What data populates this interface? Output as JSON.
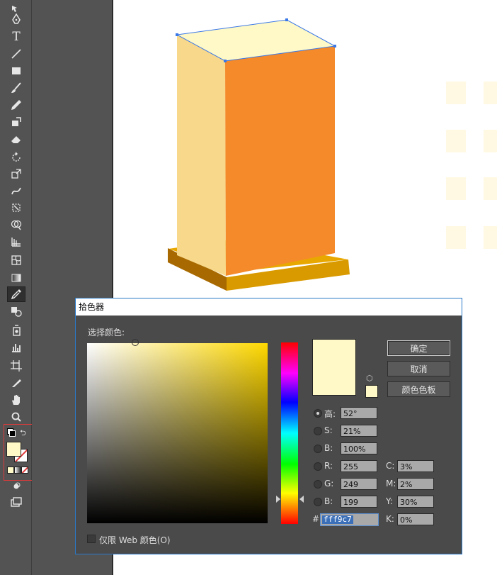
{
  "toolbar": {
    "tools": [
      {
        "name": "direct-selection-icon"
      },
      {
        "name": "pen-icon"
      },
      {
        "name": "type-icon",
        "glyph": "T"
      },
      {
        "name": "line-icon"
      },
      {
        "name": "rectangle-icon"
      },
      {
        "name": "paintbrush-icon"
      },
      {
        "name": "pencil-icon"
      },
      {
        "name": "shaper-icon"
      },
      {
        "name": "eraser-icon"
      },
      {
        "name": "rotate-icon"
      },
      {
        "name": "scale-icon"
      },
      {
        "name": "warp-icon"
      },
      {
        "name": "free-transform-icon"
      },
      {
        "name": "shape-builder-icon"
      },
      {
        "name": "perspective-grid-icon"
      },
      {
        "name": "mesh-icon"
      },
      {
        "name": "gradient-icon"
      },
      {
        "name": "eyedropper-icon",
        "selected": true
      },
      {
        "name": "blend-icon"
      },
      {
        "name": "symbol-sprayer-icon"
      },
      {
        "name": "column-graph-icon"
      },
      {
        "name": "artboard-icon"
      },
      {
        "name": "slice-icon"
      },
      {
        "name": "hand-icon"
      },
      {
        "name": "zoom-icon"
      }
    ],
    "fill_color": "#fff9c7",
    "stroke": "none"
  },
  "dialog": {
    "title": "拾色器",
    "select_label": "选择颜色:",
    "ok_label": "确定",
    "cancel_label": "取消",
    "swatches_label": "颜色色板",
    "preview_color": "#fff9c7",
    "hsb": [
      {
        "label": "高:",
        "value": "52°",
        "selected": true
      },
      {
        "label": "S:",
        "value": "21%",
        "selected": false
      },
      {
        "label": "B:",
        "value": "100%",
        "selected": false
      }
    ],
    "rgb": [
      {
        "label": "R:",
        "value": "255"
      },
      {
        "label": "G:",
        "value": "249"
      },
      {
        "label": "B:",
        "value": "199"
      }
    ],
    "cmyk": [
      {
        "label": "C:",
        "value": "3%"
      },
      {
        "label": "M:",
        "value": "2%"
      },
      {
        "label": "Y:",
        "value": "30%"
      },
      {
        "label": "K:",
        "value": "0%"
      }
    ],
    "hex_prefix": "#",
    "hex_value": "fff9c7",
    "web_only_label": "仅限 Web 颜色(O)",
    "web_only_checked": false
  },
  "colors": {
    "box_top": "#fff9c7",
    "box_left": "#f8d98c",
    "box_front": "#f48a2a",
    "base_top": "#e9a800",
    "base_side": "#a86a00",
    "selection": "#3b78e7"
  }
}
